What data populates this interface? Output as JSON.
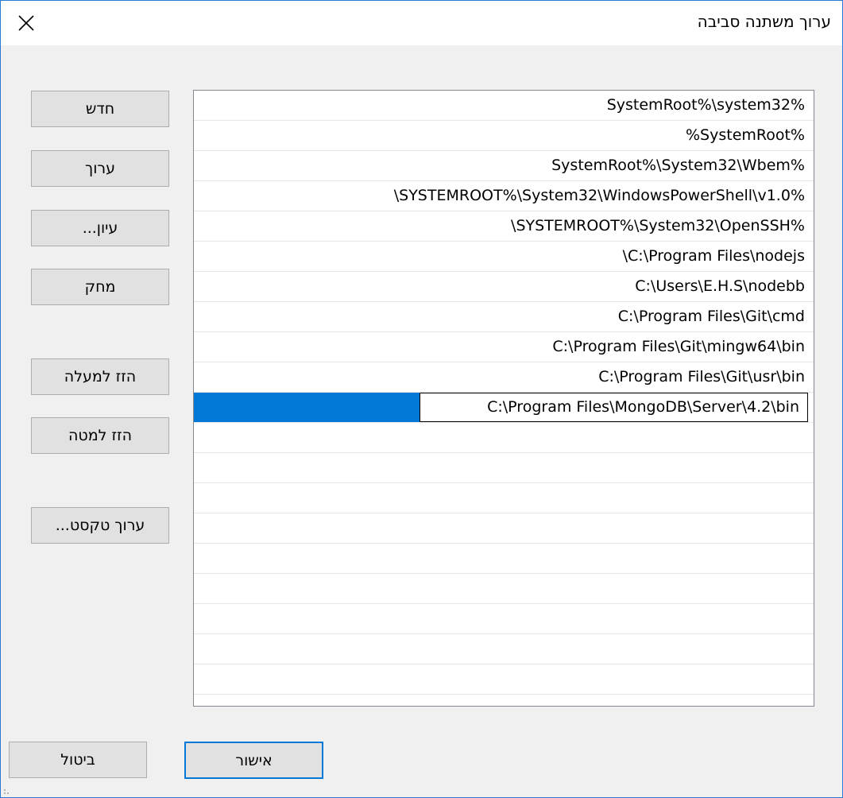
{
  "dialog": {
    "title": "ערוך משתנה סביבה",
    "close_icon": "close-icon"
  },
  "side_buttons": {
    "new": "חדש",
    "edit": "ערוך",
    "browse": "עיון...",
    "delete": "מחק",
    "move_up": "הזז למעלה",
    "move_down": "הזז למטה",
    "edit_text": "ערוך טקסט..."
  },
  "path_entries": [
    "SystemRoot%\\system32%",
    "%SystemRoot%",
    "SystemRoot%\\System32\\Wbem%",
    "\\SYSTEMROOT%\\System32\\WindowsPowerShell\\v1.0%",
    "\\SYSTEMROOT%\\System32\\OpenSSH%",
    "\\C:\\Program Files\\nodejs",
    "C:\\Users\\E.H.S\\nodebb",
    "C:\\Program Files\\Git\\cmd",
    "C:\\Program Files\\Git\\mingw64\\bin",
    "C:\\Program Files\\Git\\usr\\bin",
    "C:\\Program Files\\MongoDB\\Server\\4.2\\bin"
  ],
  "footer": {
    "ok": "אישור",
    "cancel": "ביטול"
  },
  "colors": {
    "accent": "#0078d7",
    "window_border": "#2b79d6"
  }
}
